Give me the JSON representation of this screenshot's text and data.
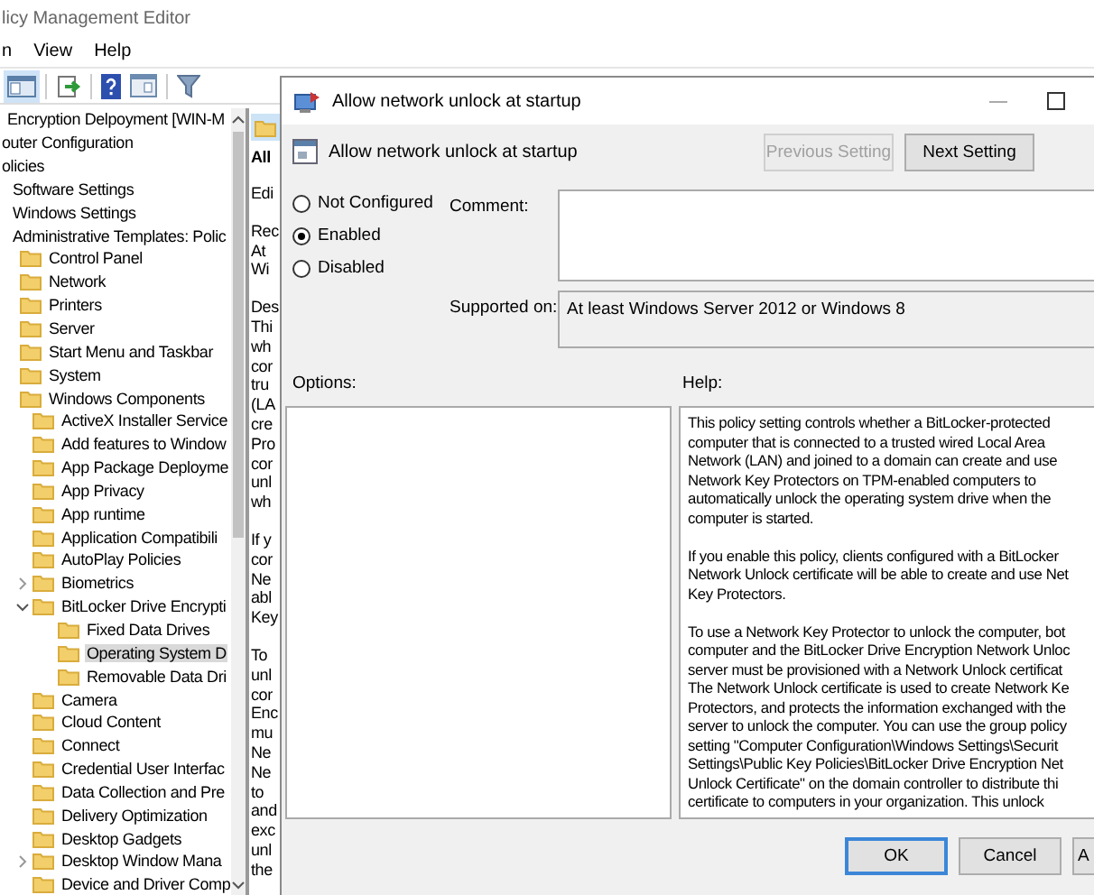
{
  "window": {
    "title": "licy Management Editor"
  },
  "menu": [
    "n",
    "View",
    "Help"
  ],
  "tree": [
    {
      "label": "Encryption Delpoyment [WIN-M",
      "children": [
        {
          "label": "outer Configuration",
          "children": [
            {
              "label": "olicies",
              "children": [
                {
                  "label": "Software Settings"
                },
                {
                  "label": "Windows Settings"
                },
                {
                  "label": "Administrative Templates: Polic",
                  "children": [
                    {
                      "label": "Control Panel",
                      "selected": false
                    },
                    {
                      "label": "Network",
                      "selected": false
                    },
                    {
                      "label": "Printers",
                      "selected": false
                    },
                    {
                      "label": "Server",
                      "selected": false
                    },
                    {
                      "label": "Start Menu and Taskbar",
                      "selected": false
                    },
                    {
                      "label": "System",
                      "selected": false
                    },
                    {
                      "label": "Windows Components",
                      "selected": false,
                      "children": [
                        {
                          "label": "ActiveX Installer Service",
                          "selected": false
                        },
                        {
                          "label": "Add features to Window",
                          "selected": false
                        },
                        {
                          "label": "App Package Deployme",
                          "selected": false
                        },
                        {
                          "label": "App Privacy",
                          "selected": false
                        },
                        {
                          "label": "App runtime",
                          "selected": false
                        },
                        {
                          "label": "Application Compatibili",
                          "selected": false
                        },
                        {
                          "label": "AutoPlay Policies",
                          "selected": false
                        },
                        {
                          "label": "Biometrics",
                          "selected": false,
                          "expanded": false
                        },
                        {
                          "label": "BitLocker Drive Encrypti",
                          "selected": false,
                          "expanded": true,
                          "children": [
                            {
                              "label": "Fixed Data Drives",
                              "selected": false
                            },
                            {
                              "label": "Operating System D",
                              "selected": true
                            },
                            {
                              "label": "Removable Data Dri",
                              "selected": false
                            }
                          ]
                        },
                        {
                          "label": "Camera",
                          "selected": false
                        },
                        {
                          "label": "Cloud Content",
                          "selected": false
                        },
                        {
                          "label": "Connect",
                          "selected": false
                        },
                        {
                          "label": "Credential User Interfac",
                          "selected": false
                        },
                        {
                          "label": "Data Collection and Pre",
                          "selected": false
                        },
                        {
                          "label": "Delivery Optimization",
                          "selected": false
                        },
                        {
                          "label": "Desktop Gadgets",
                          "selected": false
                        },
                        {
                          "label": "Desktop Window Mana",
                          "selected": false,
                          "expanded": false
                        },
                        {
                          "label": "Device and Driver Comp",
                          "selected": false
                        }
                      ]
                    }
                  ]
                }
              ]
            }
          ]
        }
      ]
    }
  ],
  "detail": {
    "heading": "All",
    "paragraphs": [
      [
        "Edi"
      ],
      [
        "Rec",
        "At",
        "Wi"
      ],
      [
        "Des",
        "Thi",
        "wh",
        "cor",
        "tru",
        "(LA",
        "cre",
        "Pro",
        "cor",
        "unl",
        "wh"
      ],
      [
        "If y",
        "cor",
        "Ne",
        "abl",
        "Key"
      ],
      [
        "To",
        "unl",
        "cor",
        "Enc",
        "mu",
        "Ne",
        "Ne",
        "to",
        "and",
        "exc",
        "unl",
        "the"
      ]
    ]
  },
  "dialog": {
    "title": "Allow network unlock at startup",
    "setting_name": "Allow network unlock at startup",
    "nav_buttons": [
      {
        "label": "Previous Setting",
        "disabled": true
      },
      {
        "label": "Next Setting",
        "disabled": false
      }
    ],
    "radios": [
      {
        "label": "Not Configured",
        "selected": false
      },
      {
        "label": "Enabled",
        "selected": true
      },
      {
        "label": "Disabled",
        "selected": false
      }
    ],
    "comment_label": "Comment:",
    "supported_label": "Supported on:",
    "supported_value": "At least Windows Server 2012 or Windows 8",
    "options_label": "Options:",
    "help_label": "Help:",
    "help": [
      [
        "This policy setting controls whether a BitLocker-protected",
        "computer that is connected to a trusted wired Local Area",
        "Network (LAN) and joined to a domain can create and use",
        "Network Key Protectors on TPM-enabled computers to",
        "automatically unlock the operating system drive when the",
        "computer is started."
      ],
      [
        "If you enable this policy, clients configured with a BitLocker",
        "Network Unlock certificate will be able to create and use Net",
        "Key Protectors."
      ],
      [
        "To use a Network Key Protector to unlock the computer, bot",
        "computer and the BitLocker Drive Encryption Network Unloc",
        "server must be provisioned with a Network Unlock certificat",
        "The Network Unlock certificate is used to create Network Ke",
        "Protectors, and protects the information exchanged with the",
        "server to unlock the computer. You can use the group policy",
        "setting \"Computer Configuration\\Windows Settings\\Securit",
        "Settings\\Public Key Policies\\BitLocker Drive Encryption Net",
        "Unlock Certificate\" on the domain controller to distribute thi",
        "certificate to computers in your organization. This unlock"
      ]
    ],
    "buttons": [
      {
        "label": "OK",
        "kind": "default"
      },
      {
        "label": "Cancel",
        "kind": "normal"
      },
      {
        "label": "A",
        "kind": "cut"
      }
    ]
  }
}
